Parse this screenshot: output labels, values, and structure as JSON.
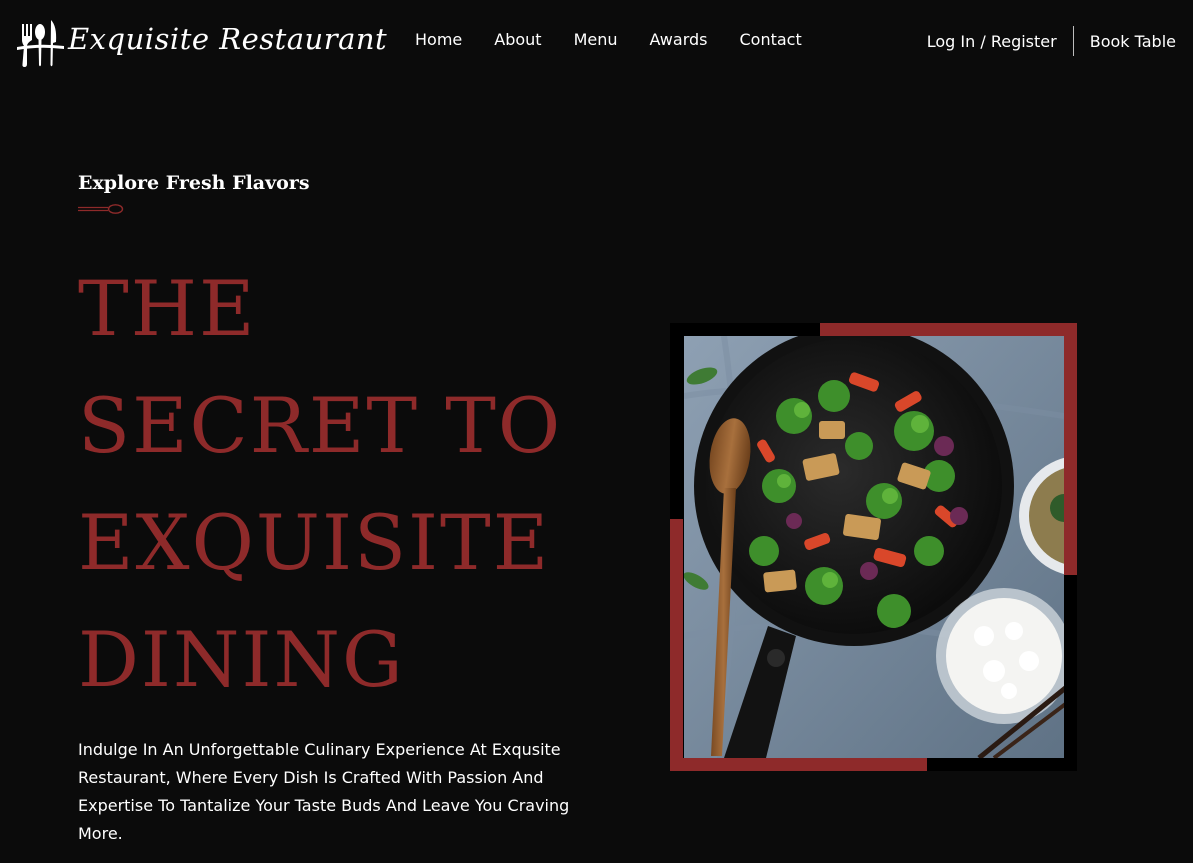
{
  "header": {
    "logo_text": "Exquisite Restaurant",
    "nav": [
      {
        "label": "Home"
      },
      {
        "label": "About"
      },
      {
        "label": "Menu"
      },
      {
        "label": "Awards"
      },
      {
        "label": "Contact"
      }
    ],
    "login_label": "Log In / Register",
    "book_label": "Book Table"
  },
  "hero": {
    "kicker": "Explore Fresh Flavors",
    "headline": [
      "THE",
      "SECRET TO",
      "EXQUISITE",
      "DINING"
    ],
    "description": "Indulge In An Unforgettable Culinary Experience At Exqusite Restaurant, Where Every Dish Is Crafted With Passion And Expertise To Tantalize Your Taste Buds And Leave You Craving More."
  },
  "colors": {
    "background": "#0b0b0b",
    "accent": "#8e2a2a",
    "text": "#ffffff"
  },
  "icons": {
    "logo": "fork-spoon-knife-logo-icon",
    "divider": "spoon-divider-icon"
  }
}
